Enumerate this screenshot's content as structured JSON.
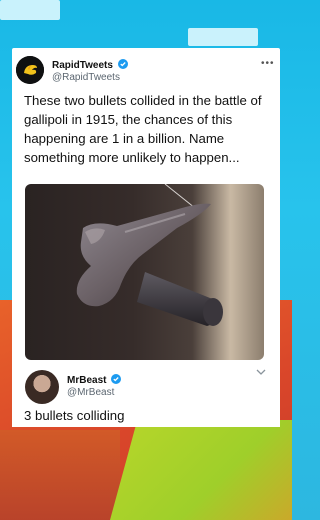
{
  "tweet": {
    "author_name": "RapidTweets",
    "author_handle": "@RapidTweets",
    "more_icon": "more-horizontal-icon",
    "text": "These two bullets collided in the battle of gallipoli in 1915, the chances of this happening are 1 in a billion. Name something more unlikely to happen...",
    "image_alt": "two bullets fused together"
  },
  "reply": {
    "author_name": "MrBeast",
    "author_handle": "@MrBeast",
    "text": "3 bullets colliding",
    "chevron_icon": "chevron-down-icon"
  },
  "colors": {
    "verified": "#1d9bf0",
    "sky": "#1fbbe8",
    "ground": "#d9462a"
  }
}
